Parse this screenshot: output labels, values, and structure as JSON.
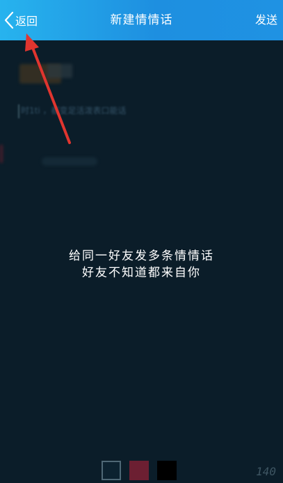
{
  "header": {
    "back_label": "返回",
    "title": "新建情情话",
    "send_label": "发送"
  },
  "background_text": "时1ti  ，都变足活泼表口能话",
  "message": {
    "line1": "给同一好友发多条情情话",
    "line2": "好友不知道都来自你"
  },
  "colors": {
    "options": [
      "#0c2230",
      "#6c1f32",
      "#000000"
    ],
    "accent": "#1e8fe0",
    "annotation_arrow": "#e0352f"
  },
  "char_counter": "140"
}
